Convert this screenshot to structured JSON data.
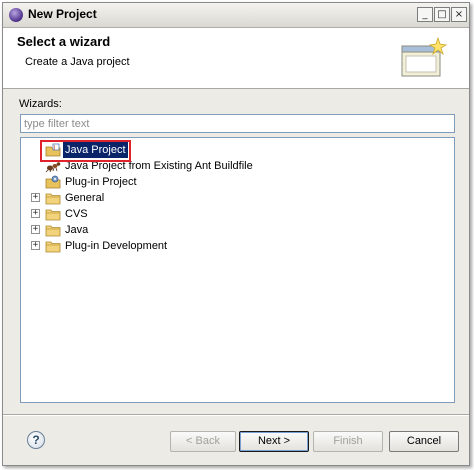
{
  "window": {
    "title": "New Project"
  },
  "title_buttons": {
    "minimize": "_",
    "maximize": "□",
    "close": "×"
  },
  "header": {
    "title": "Select a wizard",
    "description": "Create a Java project"
  },
  "wizards": {
    "label": "Wizards:",
    "filter_placeholder": "type filter text",
    "filter_value": ""
  },
  "tree": {
    "items": [
      {
        "label": "Java Project",
        "icon": "java-project-icon",
        "selected": true
      },
      {
        "label": "Java Project from Existing Ant Buildfile",
        "icon": "ant-project-icon",
        "selected": false
      },
      {
        "label": "Plug-in Project",
        "icon": "plugin-project-icon",
        "selected": false
      },
      {
        "label": "General",
        "icon": "folder-icon",
        "expander": "+"
      },
      {
        "label": "CVS",
        "icon": "folder-icon",
        "expander": "+"
      },
      {
        "label": "Java",
        "icon": "folder-icon",
        "expander": "+"
      },
      {
        "label": "Plug-in Development",
        "icon": "folder-icon",
        "expander": "+"
      }
    ]
  },
  "buttons": {
    "help": "?",
    "back": "< Back",
    "next": "Next >",
    "finish": "Finish",
    "cancel": "Cancel"
  },
  "colors": {
    "selection": "#0a246a",
    "highlight_box": "#e0222a",
    "folder": "#e8c25a"
  }
}
